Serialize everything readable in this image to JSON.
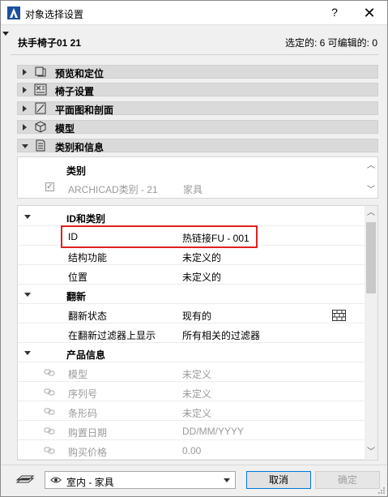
{
  "window": {
    "title": "对象选择设置",
    "help": "?",
    "close": "✕"
  },
  "header": {
    "object_name": "扶手椅子01 21",
    "selection_info": "选定的: 6 可编辑的: 0"
  },
  "sections": [
    {
      "label": "预览和定位",
      "icon": "preview-icon",
      "open": false
    },
    {
      "label": "椅子设置",
      "icon": "chair-settings-icon",
      "open": false
    },
    {
      "label": "平面图和剖面",
      "icon": "floorplan-icon",
      "open": false
    },
    {
      "label": "模型",
      "icon": "model-cube-icon",
      "open": false
    },
    {
      "label": "类别和信息",
      "icon": "document-icon",
      "open": true
    }
  ],
  "category": {
    "heading": "类别",
    "row_key": "ARCHICAD类别 - 21",
    "row_value": "家具"
  },
  "properties": {
    "group_id": "ID和类别",
    "id_key": "ID",
    "id_value": "热链接FU - 001",
    "func_key": "结构功能",
    "func_value": "未定义的",
    "pos_key": "位置",
    "pos_value": "未定义的",
    "group_renovation": "翻新",
    "reno_status_key": "翻新状态",
    "reno_status_value": "现有的",
    "reno_filter_key": "在翻新过滤器上显示",
    "reno_filter_value": "所有相关的过滤器",
    "group_product": "产品信息",
    "model_key": "模型",
    "model_value": "未定义",
    "serial_key": "序列号",
    "serial_value": "未定义",
    "barcode_key": "条形码",
    "barcode_value": "未定义",
    "date_key": "购置日期",
    "date_value": "DD/MM/YYYY",
    "price_key": "购买价格",
    "price_value": "0.00"
  },
  "footer": {
    "layer": "室内 - 家具",
    "cancel_label": "取消",
    "ok_label": "确定"
  }
}
